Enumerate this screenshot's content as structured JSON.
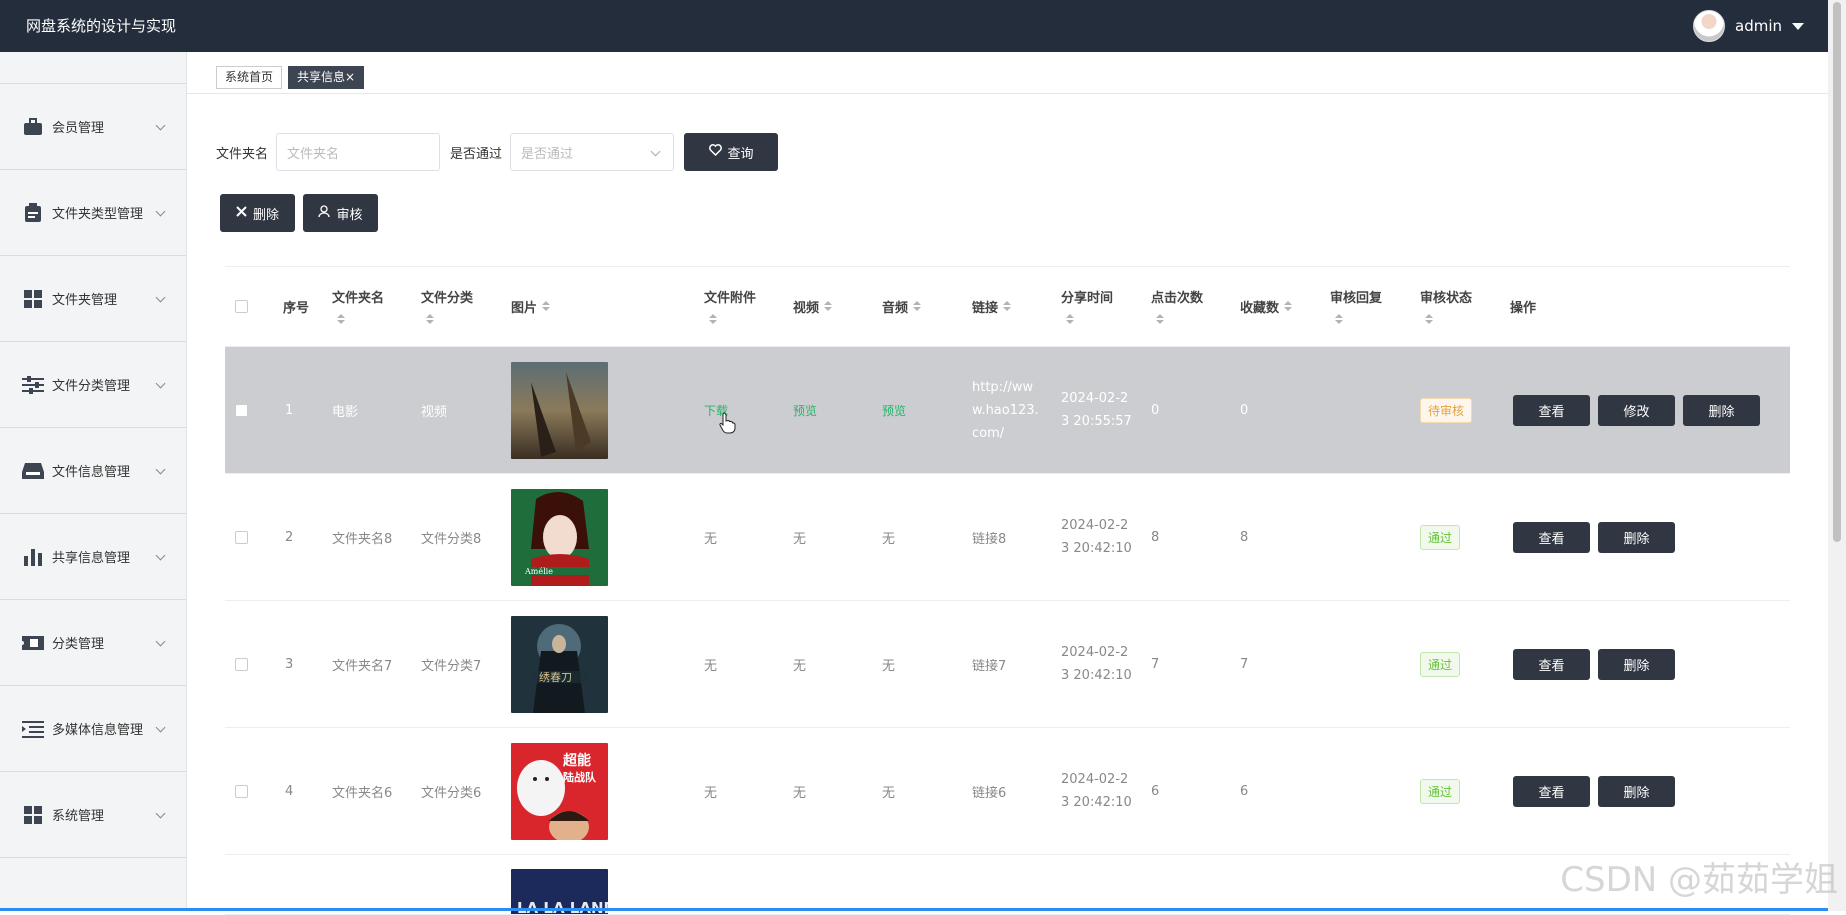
{
  "app": {
    "title": "网盘系统的设计与实现",
    "user": "admin"
  },
  "sidebar": {
    "items": [
      {
        "label": "会员管理",
        "icon": "briefcase-icon"
      },
      {
        "label": "文件夹类型管理",
        "icon": "clipboard-icon"
      },
      {
        "label": "文件夹管理",
        "icon": "grid-icon"
      },
      {
        "label": "文件分类管理",
        "icon": "sliders-icon"
      },
      {
        "label": "文件信息管理",
        "icon": "inbox-icon"
      },
      {
        "label": "共享信息管理",
        "icon": "bar-chart-icon"
      },
      {
        "label": "分类管理",
        "icon": "ticket-icon"
      },
      {
        "label": "多媒体信息管理",
        "icon": "indent-icon"
      },
      {
        "label": "系统管理",
        "icon": "grid-icon"
      }
    ]
  },
  "tabs": [
    {
      "label": "系统首页"
    },
    {
      "label": "共享信息×",
      "active": true
    }
  ],
  "search": {
    "folder_label": "文件夹名",
    "folder_placeholder": "文件夹名",
    "pass_label": "是否通过",
    "pass_placeholder": "是否通过",
    "query_button": "查询"
  },
  "actions": {
    "delete": "删除",
    "review": "审核"
  },
  "table": {
    "headers": {
      "index": "序号",
      "folder": "文件夹名",
      "category": "文件分类",
      "image": "图片",
      "attachment": "文件附件",
      "video": "视频",
      "audio": "音频",
      "link": "链接",
      "time": "分享时间",
      "clicks": "点击次数",
      "favorites": "收藏数",
      "reply": "审核回复",
      "status": "审核状态",
      "ops": "操作"
    },
    "ops": {
      "view": "查看",
      "edit": "修改",
      "delete": "删除"
    },
    "rows": [
      {
        "index": "1",
        "folder": "电影",
        "category": "视频",
        "attachment": "下载",
        "video": "预览",
        "audio": "预览",
        "link": "http://www.hao123.com/",
        "time": "2024-02-23 20:55:57",
        "clicks": "0",
        "favorites": "0",
        "reply": "",
        "status": "待审核",
        "status_type": "pending"
      },
      {
        "index": "2",
        "folder": "文件夹名8",
        "category": "文件分类8",
        "attachment": "无",
        "video": "无",
        "audio": "无",
        "link": "链接8",
        "time": "2024-02-23 20:42:10",
        "clicks": "8",
        "favorites": "8",
        "reply": "",
        "status": "通过",
        "status_type": "ok"
      },
      {
        "index": "3",
        "folder": "文件夹名7",
        "category": "文件分类7",
        "attachment": "无",
        "video": "无",
        "audio": "无",
        "link": "链接7",
        "time": "2024-02-23 20:42:10",
        "clicks": "7",
        "favorites": "7",
        "reply": "",
        "status": "通过",
        "status_type": "ok"
      },
      {
        "index": "4",
        "folder": "文件夹名6",
        "category": "文件分类6",
        "attachment": "无",
        "video": "无",
        "audio": "无",
        "link": "链接6",
        "time": "2024-02-23 20:42:10",
        "clicks": "6",
        "favorites": "6",
        "reply": "",
        "status": "通过",
        "status_type": "ok"
      }
    ]
  },
  "watermark": "CSDN @茹茹学姐",
  "colors": {
    "topbar": "#242d3c",
    "button": "#303642",
    "link_green": "#26b36a",
    "highlight_row": "#cccdd0"
  }
}
